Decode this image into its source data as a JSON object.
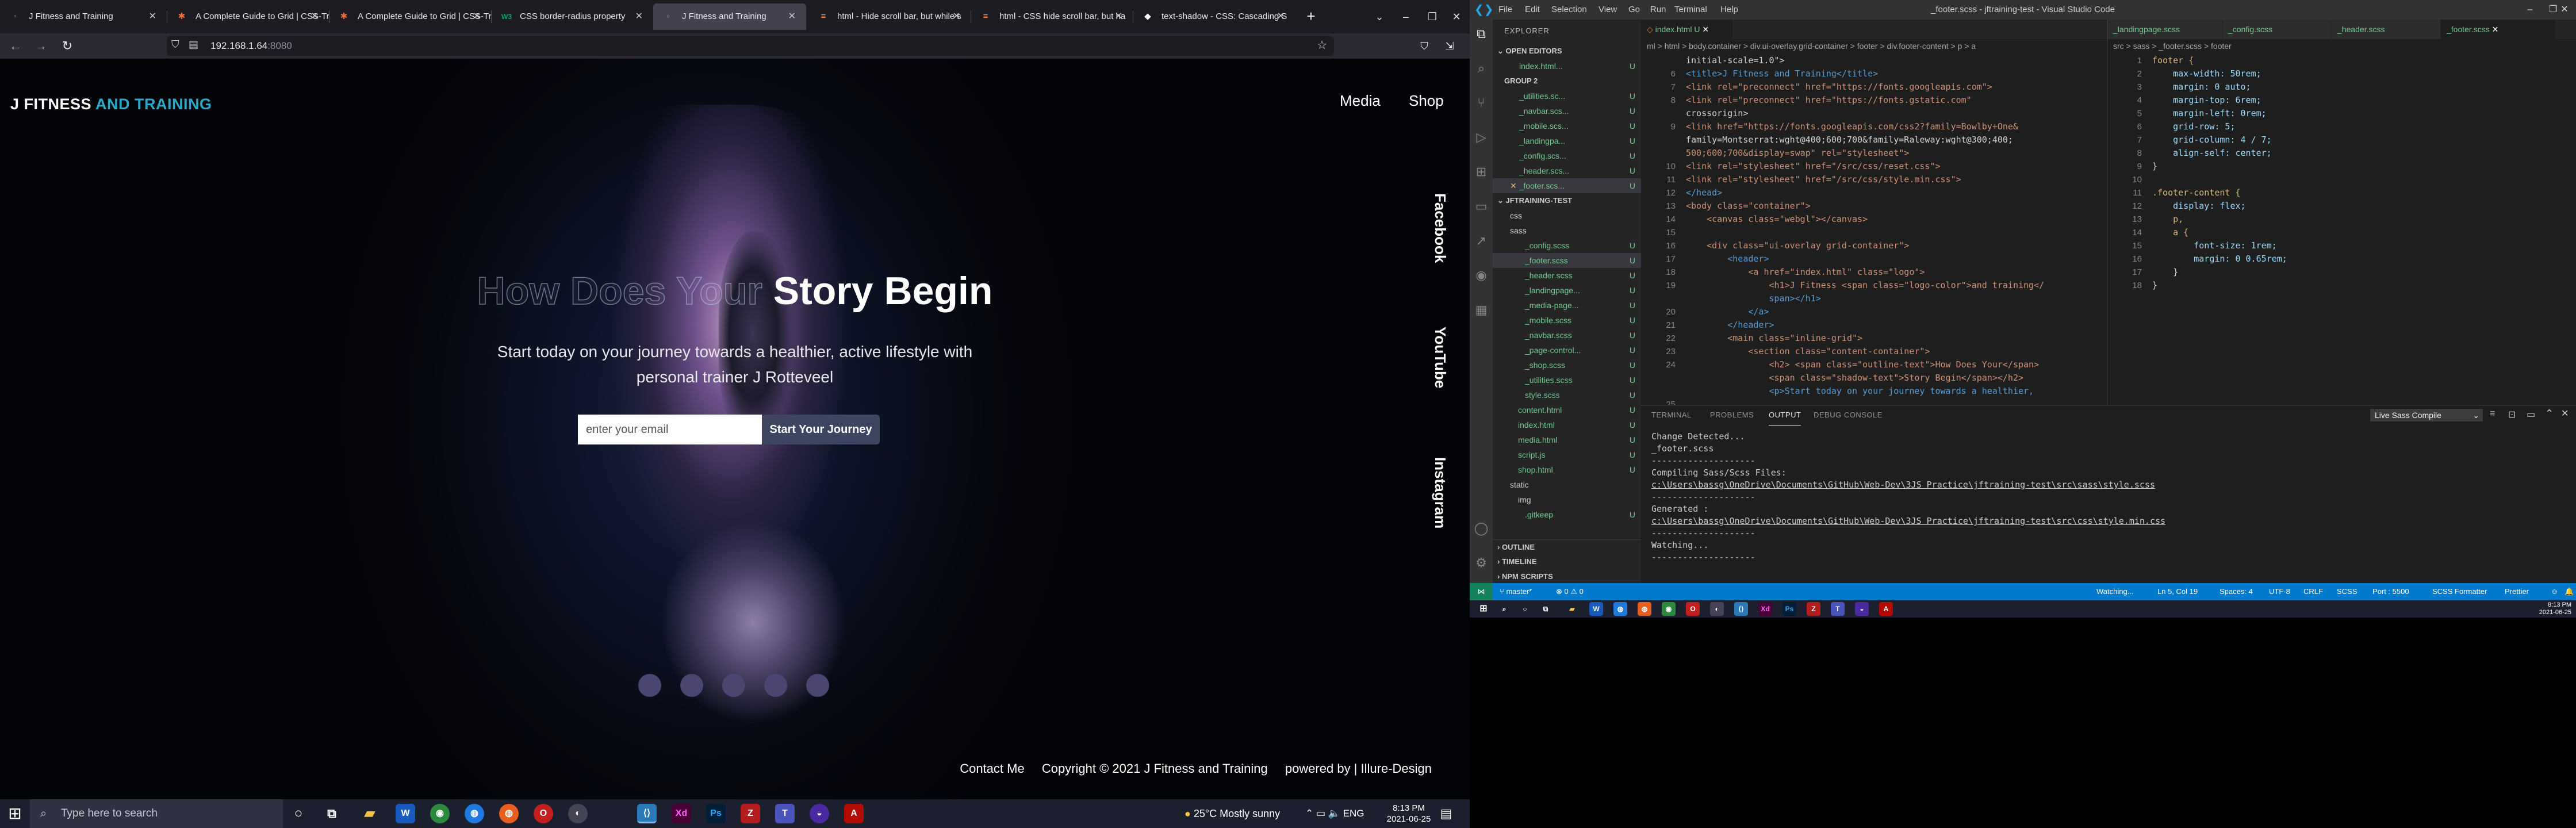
{
  "browser": {
    "tabs": [
      {
        "title": "J Fitness and Training",
        "icon": "page-icon"
      },
      {
        "title": "A Complete Guide to Grid | CSS-Tricks",
        "icon": "css-tricks-icon"
      },
      {
        "title": "A Complete Guide to Grid | CSS-Tricks",
        "icon": "css-tricks-icon"
      },
      {
        "title": "CSS border-radius property",
        "icon": "w3schools-icon"
      },
      {
        "title": "J Fitness and Training",
        "icon": "page-icon"
      },
      {
        "title": "html - Hide scroll bar, but while s",
        "icon": "stackoverflow-icon"
      },
      {
        "title": "html - CSS hide scroll bar, but ha",
        "icon": "stackoverflow-icon"
      },
      {
        "title": "text-shadow - CSS: Cascading S",
        "icon": "mdn-icon"
      }
    ],
    "url_host": "192.168.1.64",
    "url_port": ":8080"
  },
  "page": {
    "logo_main": "J FITNESS",
    "logo_accent": "AND TRAINING",
    "nav": [
      "Media",
      "Shop"
    ],
    "social": [
      "Facebook",
      "YouTube",
      "Instagram"
    ],
    "hero_outline": "How Does Your",
    "hero_solid": "Story Begin",
    "hero_sub": "Start today on your journey towards a healthier, active lifestyle with personal trainer J Rotteveel",
    "email_placeholder": "enter your email",
    "cta": "Start Your Journey",
    "footer": [
      "Contact Me",
      "Copyright © 2021 J Fitness and Training",
      "powered by |  Illure-Design"
    ]
  },
  "taskbar": {
    "search_placeholder": "Type here to search",
    "weather": "25°C  Mostly sunny",
    "lang": "ENG",
    "time": "8:13 PM",
    "date": "2021-06-25"
  },
  "vscode": {
    "menu": [
      "File",
      "Edit",
      "Selection",
      "View",
      "Go",
      "Run",
      "Terminal",
      "Help"
    ],
    "title": "_footer.scss - jftraining-test - Visual Studio Code",
    "explorer_title": "EXPLORER",
    "open_editors": "OPEN EDITORS",
    "group2": "GROUP 2",
    "open_files": [
      "index.html...",
      "_utilities.sc...",
      "_navbar.scs...",
      "_mobile.scs...",
      "_landingpa...",
      "_config.scs...",
      "_header.scs...",
      "_footer.scs..."
    ],
    "project": "JFTRAINING-TEST",
    "tree": [
      "css",
      "sass",
      "_config.scss",
      "_footer.scss",
      "_header.scss",
      "_landingpage...",
      "_media-page...",
      "_mobile.scss",
      "_navbar.scss",
      "_page-control...",
      "_shop.scss",
      "_utilities.scss",
      "style.scss",
      "content.html",
      "index.html",
      "media.html",
      "script.js",
      "shop.html",
      "static",
      "img",
      ".gitkeep"
    ],
    "outline": "OUTLINE",
    "timeline": "TIMELINE",
    "npm": "NPM SCRIPTS",
    "ed1_tabs": [
      "index.html U"
    ],
    "ed1_crumbs": "ml > html > body.container > div.ui-overlay.grid-container > footer > div.footer-content > p > a",
    "ed1_lines": [
      {
        "n": "",
        "t": "initial-scale=1.0\">"
      },
      {
        "n": "6",
        "t": "<title>J Fitness and Training</title>"
      },
      {
        "n": "7",
        "t": "<link rel=\"preconnect\" href=\"https://fonts.googleapis.com\">"
      },
      {
        "n": "8",
        "t": "<link rel=\"preconnect\" href=\"https://fonts.gstatic.com\""
      },
      {
        "n": "",
        "t": "crossorigin>"
      },
      {
        "n": "9",
        "t": "<link href=\"https://fonts.googleapis.com/css2?family=Bowlby+One&"
      },
      {
        "n": "",
        "t": "family=Montserrat:wght@400;600;700&family=Raleway:wght@300;400;"
      },
      {
        "n": "",
        "t": "500;600;700&display=swap\" rel=\"stylesheet\">"
      },
      {
        "n": "10",
        "t": "<link rel=\"stylesheet\" href=\"/src/css/reset.css\">"
      },
      {
        "n": "11",
        "t": "<link rel=\"stylesheet\" href=\"/src/css/style.min.css\">"
      },
      {
        "n": "12",
        "t": "</head>"
      },
      {
        "n": "13",
        "t": "<body class=\"container\">"
      },
      {
        "n": "14",
        "t": "    <canvas class=\"webgl\"></canvas>"
      },
      {
        "n": "15",
        "t": ""
      },
      {
        "n": "16",
        "t": "    <div class=\"ui-overlay grid-container\">"
      },
      {
        "n": "17",
        "t": "        <header>"
      },
      {
        "n": "18",
        "t": "            <a href=\"index.html\" class=\"logo\">"
      },
      {
        "n": "19",
        "t": "                <h1>J Fitness <span class=\"logo-color\">and training</"
      },
      {
        "n": "",
        "t": "                span></h1>"
      },
      {
        "n": "20",
        "t": "            </a>"
      },
      {
        "n": "21",
        "t": "        </header>"
      },
      {
        "n": "22",
        "t": "        <main class=\"inline-grid\">"
      },
      {
        "n": "23",
        "t": "            <section class=\"content-container\">"
      },
      {
        "n": "24",
        "t": "                <h2> <span class=\"outline-text\">How Does Your</span>"
      },
      {
        "n": "",
        "t": "                <span class=\"shadow-text\">Story Begin</span></h2>"
      },
      {
        "n": "",
        "t": "                <p>Start today on your journey towards a healthier,"
      },
      {
        "n": "25",
        "t": ""
      }
    ],
    "ed2_tabs": [
      "_landingpage.scss",
      "_config.scss",
      "_header.scss",
      "_footer.scss"
    ],
    "ed2_crumbs": "src > sass > _footer.scss > footer",
    "ed2_lines": [
      {
        "n": "1",
        "t": "footer {"
      },
      {
        "n": "2",
        "t": "    max-width: 50rem;"
      },
      {
        "n": "3",
        "t": "    margin: 0 auto;"
      },
      {
        "n": "4",
        "t": "    margin-top: 6rem;"
      },
      {
        "n": "5",
        "t": "    margin-left: 0rem;"
      },
      {
        "n": "6",
        "t": "    grid-row: 5;"
      },
      {
        "n": "7",
        "t": "    grid-column: 4 / 7;"
      },
      {
        "n": "8",
        "t": "    align-self: center;"
      },
      {
        "n": "9",
        "t": "}"
      },
      {
        "n": "10",
        "t": ""
      },
      {
        "n": "11",
        "t": ".footer-content {"
      },
      {
        "n": "12",
        "t": "    display: flex;"
      },
      {
        "n": "13",
        "t": "    p,"
      },
      {
        "n": "14",
        "t": "    a {"
      },
      {
        "n": "15",
        "t": "        font-size: 1rem;"
      },
      {
        "n": "16",
        "t": "        margin: 0 0.65rem;"
      },
      {
        "n": "17",
        "t": "    }"
      },
      {
        "n": "18",
        "t": "}"
      }
    ],
    "panel_tabs": [
      "TERMINAL",
      "PROBLEMS",
      "OUTPUT",
      "DEBUG CONSOLE"
    ],
    "panel_select": "Live Sass Compile",
    "output": [
      "Change Detected...",
      "_footer.scss",
      "--------------------",
      "Compiling Sass/Scss Files:",
      "c:\\Users\\bassg\\OneDrive\\Documents\\GitHub\\Web-Dev\\3JS Practice\\jftraining-test\\src\\sass\\style.scss",
      "--------------------",
      "Generated :",
      "c:\\Users\\bassg\\OneDrive\\Documents\\GitHub\\Web-Dev\\3JS Practice\\jftraining-test\\src\\css\\style.min.css",
      "--------------------",
      "Watching...",
      "--------------------"
    ],
    "status_left": [
      "master*",
      "⊗ 0 ⚠ 0"
    ],
    "status_right": [
      "Watching...",
      "Ln 5, Col 19",
      "Spaces: 4",
      "UTF-8",
      "CRLF",
      "SCSS",
      "Port : 5500",
      "SCSS Formatter",
      "Prettier"
    ]
  }
}
